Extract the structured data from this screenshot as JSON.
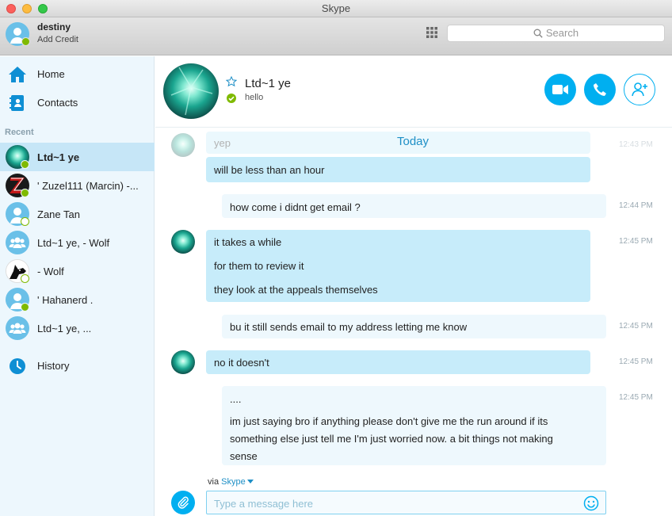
{
  "window": {
    "title": "Skype"
  },
  "me": {
    "name": "destiny",
    "credit": "Add Credit"
  },
  "search": {
    "placeholder": "Search"
  },
  "nav": {
    "home": "Home",
    "contacts": "Contacts",
    "recent": "Recent",
    "history": "History"
  },
  "contacts": [
    {
      "name": "Ltd~1 ye"
    },
    {
      "name": "' Zuzel111 (Marcin) -..."
    },
    {
      "name": "Zane Tan"
    },
    {
      "name": "Ltd~1 ye, - Wolf"
    },
    {
      "name": "- Wolf"
    },
    {
      "name": "' Hahanerd  ."
    },
    {
      "name": "Ltd~1 ye, ..."
    }
  ],
  "chat": {
    "name": "Ltd~1 ye",
    "mood": "hello"
  },
  "divider": "Today",
  "messages": [
    {
      "lines": [
        "yep"
      ],
      "time": "12:43 PM"
    },
    {
      "lines": [
        "will be less than an hour"
      ]
    },
    {
      "lines": [
        "how come i didnt get email ?"
      ],
      "time": "12:44 PM"
    },
    {
      "lines": [
        "it takes a while",
        "for them to review it",
        "they look at the appeals themselves"
      ],
      "time": "12:45 PM"
    },
    {
      "lines": [
        "bu it still sends email to my address letting me know"
      ],
      "time": "12:45 PM"
    },
    {
      "lines": [
        "no it doesn't"
      ],
      "time": "12:45 PM"
    },
    {
      "lines": [
        "....",
        "im just saying bro if anything please don't give me the run around if its",
        "something else just tell me I'm just worried now. a bit things not making",
        "sense"
      ],
      "time": "12:45 PM"
    }
  ],
  "via": {
    "prefix": "via",
    "service": "Skype"
  },
  "composer": {
    "placeholder": "Type a message here"
  },
  "colors": {
    "accent": "#00aff0",
    "online": "#7fba00",
    "incoming": "#c7ecfa",
    "outgoing": "#eef8fd"
  }
}
